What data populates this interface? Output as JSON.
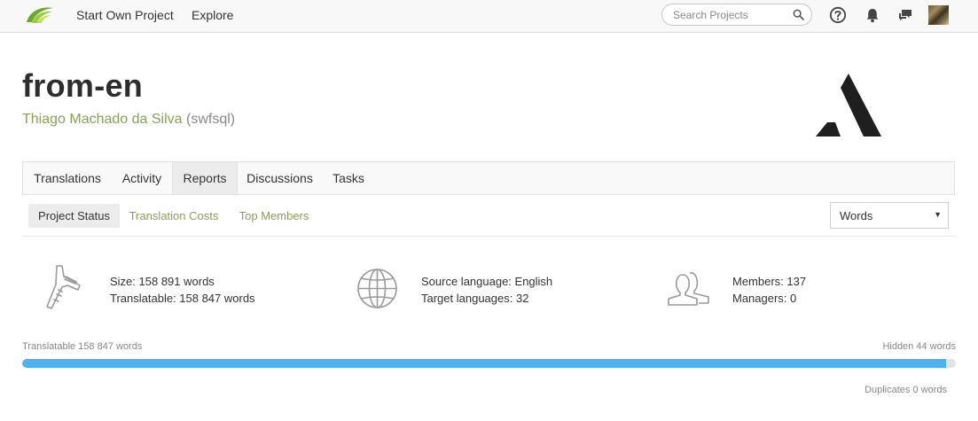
{
  "nav": {
    "links": [
      "Start Own Project",
      "Explore"
    ],
    "search_placeholder": "Search Projects",
    "icons": [
      "help-icon",
      "notifications-bell-icon",
      "messages-icon"
    ]
  },
  "project": {
    "title": "from-en",
    "owner_name": "Thiago Machado da Silva",
    "owner_handle": "(swfsql)"
  },
  "tabs": [
    "Translations",
    "Activity",
    "Reports",
    "Discussions",
    "Tasks"
  ],
  "active_tab": "Reports",
  "subtabs": [
    "Project Status",
    "Translation Costs",
    "Top Members"
  ],
  "active_subtab": "Project Status",
  "units_select": {
    "value": "Words"
  },
  "stats": {
    "size": "Size: 158 891 words",
    "translatable": "Translatable: 158 847 words",
    "source_language": "Source language: English",
    "target_languages": "Target languages: 32",
    "members": "Members: 137",
    "managers": "Managers: 0"
  },
  "progress": {
    "translatable_label": "Translatable 158 847 words",
    "hidden_label": "Hidden 44 words",
    "duplicates_label": "Duplicates 0 words",
    "translatable_fraction": 0.99,
    "colors": {
      "fill": "#4ab4f0",
      "track": "#e3e3e3"
    }
  },
  "colors": {
    "accent_green": "#8aa05a"
  }
}
